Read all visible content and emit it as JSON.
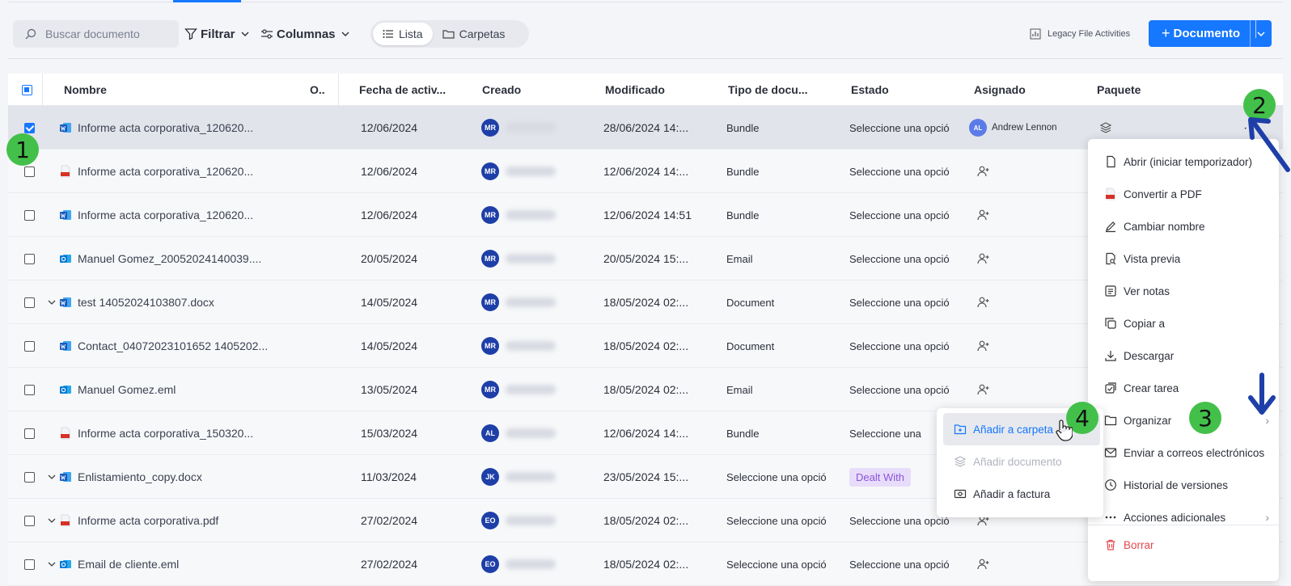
{
  "toolbar": {
    "search_placeholder": "Buscar documento",
    "filter_label": "Filtrar",
    "columns_label": "Columnas",
    "view_list_label": "Lista",
    "view_folders_label": "Carpetas",
    "legacy_label": "Legacy File Activities",
    "new_document_label": "Documento",
    "new_document_plus": "+"
  },
  "table": {
    "headers": {
      "name": "Nombre",
      "o": "O..",
      "activity_date": "Fecha de activ...",
      "created": "Creado",
      "modified": "Modificado",
      "doc_type": "Tipo de docu...",
      "status": "Estado",
      "assigned": "Asignado",
      "package": "Paquete"
    },
    "rows": [
      {
        "name": "Informe acta corporativa_120620...",
        "icon": "word-icon",
        "date": "12/06/2024",
        "avatar": "MR",
        "modified": "28/06/2024 14:...",
        "type": "Bundle",
        "status": "Seleccione una opció",
        "assigned": "Andrew Lennon",
        "assigned_initials": "AL",
        "checked": true
      },
      {
        "name": "Informe acta corporativa_120620...",
        "icon": "pdf-icon",
        "date": "12/06/2024",
        "avatar": "MR",
        "modified": "12/06/2024 14:...",
        "type": "Bundle",
        "status": "Seleccione una opció"
      },
      {
        "name": "Informe acta corporativa_120620...",
        "icon": "word-icon",
        "date": "12/06/2024",
        "avatar": "MR",
        "modified": "12/06/2024 14:51",
        "type": "Bundle",
        "status": "Seleccione una opció"
      },
      {
        "name": "Manuel Gomez_20052024140039....",
        "icon": "outlook-icon",
        "date": "20/05/2024",
        "avatar": "MR",
        "modified": "20/05/2024 15:...",
        "type": "Email",
        "status": "Seleccione una opció"
      },
      {
        "name": "test 14052024103807.docx",
        "icon": "word-icon",
        "date": "14/05/2024",
        "avatar": "MR",
        "modified": "18/05/2024 02:...",
        "type": "Document",
        "status": "Seleccione una opció",
        "expander": true
      },
      {
        "name": "Contact_04072023101652 1405202...",
        "icon": "word-icon",
        "date": "14/05/2024",
        "avatar": "MR",
        "modified": "18/05/2024 02:...",
        "type": "Document",
        "status": "Seleccione una opció"
      },
      {
        "name": "Manuel Gomez.eml",
        "icon": "outlook-icon",
        "date": "13/05/2024",
        "avatar": "MR",
        "modified": "18/05/2024 02:...",
        "type": "Email",
        "status": "Seleccione una opció"
      },
      {
        "name": "Informe acta corporativa_150320...",
        "icon": "pdf-icon",
        "date": "15/03/2024",
        "avatar": "AL",
        "modified": "12/06/2024 14:...",
        "type": "Bundle",
        "status": "Seleccione una"
      },
      {
        "name": "Enlistamiento_copy.docx",
        "icon": "word-icon",
        "date": "11/03/2024",
        "avatar": "JK",
        "modified": "23/05/2024 15:...",
        "type": "Seleccione una opció",
        "status_badge": "Dealt With",
        "expander": true
      },
      {
        "name": "Informe acta corporativa.pdf",
        "icon": "pdf-icon",
        "date": "27/02/2024",
        "avatar": "EO",
        "modified": "18/05/2024 02:...",
        "type": "Seleccione una opció",
        "status": "Seleccione una opció",
        "expander": true
      },
      {
        "name": "Email de cliente.eml",
        "icon": "outlook-icon",
        "date": "27/02/2024",
        "avatar": "EO",
        "modified": "18/05/2024 02:...",
        "type": "Seleccione una opció",
        "status": "Seleccione una opció",
        "expander": true
      }
    ]
  },
  "context_menu": {
    "items": [
      {
        "label": "Abrir (iniciar temporizador)",
        "icon": "file-icon"
      },
      {
        "label": "Convertir a PDF",
        "icon": "pdf-icon"
      },
      {
        "label": "Cambiar nombre",
        "icon": "pencil-icon"
      },
      {
        "label": "Vista previa",
        "icon": "preview-icon"
      },
      {
        "label": "Ver notas",
        "icon": "notes-icon"
      },
      {
        "label": "Copiar a",
        "icon": "copy-icon"
      },
      {
        "label": "Descargar",
        "icon": "download-icon"
      },
      {
        "label": "Crear tarea",
        "icon": "task-icon"
      },
      {
        "label": "Organizar",
        "icon": "folder-icon"
      },
      {
        "label": "Enviar a correos electrónicos",
        "icon": "mail-icon"
      },
      {
        "label": "Historial de versiones",
        "icon": "clock-icon"
      },
      {
        "label": "Acciones adicionales",
        "icon": "more-icon"
      },
      {
        "label": "Borrar",
        "icon": "trash-icon"
      }
    ]
  },
  "submenu": {
    "items": [
      {
        "label": "Añadir a carpeta",
        "icon": "folder-add-icon"
      },
      {
        "label": "Añadir documento",
        "icon": "layers-icon"
      },
      {
        "label": "Añadir a factura",
        "icon": "invoice-icon"
      }
    ]
  },
  "steps": [
    "1",
    "2",
    "3",
    "4"
  ],
  "colors": {
    "accent": "#1677ff",
    "step": "#43c04a",
    "danger": "#e5484d"
  }
}
